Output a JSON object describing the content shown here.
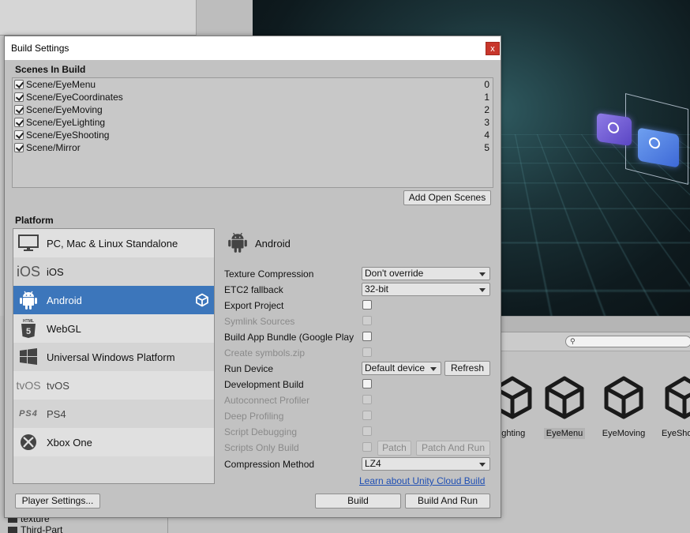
{
  "window": {
    "title": "Build Settings",
    "close_glyph": "x"
  },
  "scenes": {
    "heading": "Scenes In Build",
    "items": [
      {
        "name": "Scene/EyeMenu",
        "index": "0",
        "checked": true
      },
      {
        "name": "Scene/EyeCoordinates",
        "index": "1",
        "checked": true
      },
      {
        "name": "Scene/EyeMoving",
        "index": "2",
        "checked": true
      },
      {
        "name": "Scene/EyeLighting",
        "index": "3",
        "checked": true
      },
      {
        "name": "Scene/EyeShooting",
        "index": "4",
        "checked": true
      },
      {
        "name": "Scene/Mirror",
        "index": "5",
        "checked": true
      }
    ],
    "add_open_scenes": "Add Open Scenes"
  },
  "platform": {
    "heading": "Platform",
    "items": [
      {
        "name": "PC, Mac & Linux Standalone",
        "icon": "monitor-icon"
      },
      {
        "name": "iOS",
        "icon": "ios-icon",
        "icon_text": "iOS"
      },
      {
        "name": "Android",
        "icon": "android-icon",
        "selected": true
      },
      {
        "name": "WebGL",
        "icon": "html5-icon",
        "icon_text": "HTML"
      },
      {
        "name": "Universal Windows Platform",
        "icon": "windows-icon"
      },
      {
        "name": "tvOS",
        "icon": "tvos-icon",
        "icon_text": "tvOS"
      },
      {
        "name": "PS4",
        "icon": "ps4-icon",
        "icon_text": "PS4"
      },
      {
        "name": "Xbox One",
        "icon": "xbox-icon"
      }
    ],
    "player_settings": "Player Settings..."
  },
  "android": {
    "title": "Android",
    "texture_compression": {
      "label": "Texture Compression",
      "value": "Don't override"
    },
    "etc2_fallback": {
      "label": "ETC2 fallback",
      "value": "32-bit"
    },
    "export_project": {
      "label": "Export Project"
    },
    "symlink_sources": {
      "label": "Symlink Sources"
    },
    "build_app_bundle": {
      "label": "Build App Bundle (Google Play"
    },
    "create_symbols": {
      "label": "Create symbols.zip"
    },
    "run_device": {
      "label": "Run Device",
      "value": "Default device",
      "refresh": "Refresh"
    },
    "development_build": {
      "label": "Development Build"
    },
    "autoconnect_profiler": {
      "label": "Autoconnect Profiler"
    },
    "deep_profiling": {
      "label": "Deep Profiling"
    },
    "script_debugging": {
      "label": "Script Debugging"
    },
    "scripts_only_build": {
      "label": "Scripts Only Build",
      "patch": "Patch",
      "patch_and_run": "Patch And Run"
    },
    "compression_method": {
      "label": "Compression Method",
      "value": "LZ4"
    },
    "cloud_link": "Learn about Unity Cloud Build",
    "build": "Build",
    "build_and_run": "Build And Run"
  },
  "background": {
    "assets": [
      {
        "label": "ighting"
      },
      {
        "label": "EyeMenu",
        "selected": true
      },
      {
        "label": "EyeMoving"
      },
      {
        "label": "EyeSho"
      }
    ],
    "folders": [
      "texture",
      "Third-Part"
    ]
  },
  "colors": {
    "selection": "#3c76bb",
    "link": "#1f4fb3",
    "close": "#c8362b"
  }
}
